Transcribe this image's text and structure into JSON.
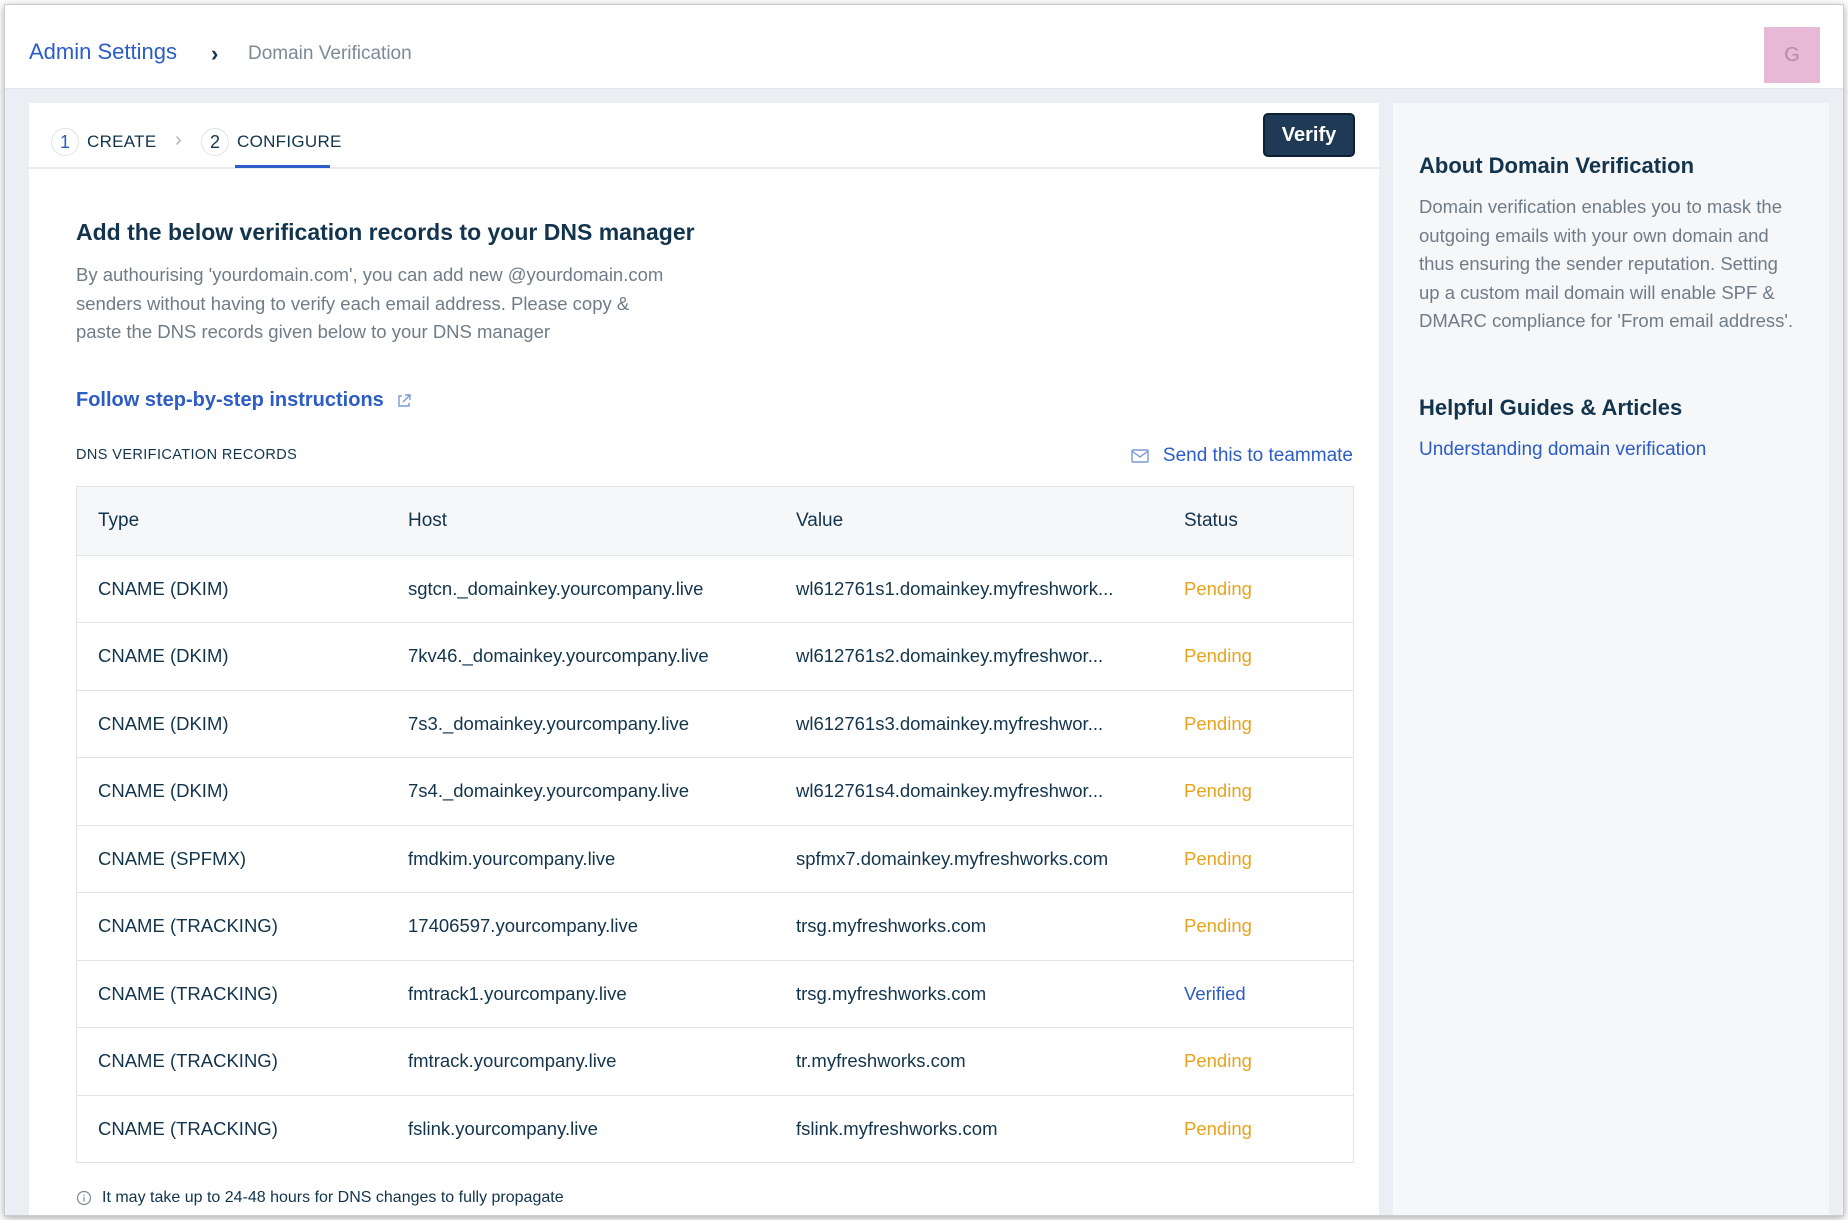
{
  "header": {
    "breadcrumb_root": "Admin Settings",
    "breadcrumb_separator": "›",
    "breadcrumb_current": "Domain Verification",
    "avatar_initial": "G"
  },
  "stepper": {
    "steps": [
      {
        "number": "1",
        "label": "CREATE"
      },
      {
        "number": "2",
        "label": "CONFIGURE"
      }
    ],
    "separator": "›",
    "active_step": 2,
    "verify_label": "Verify"
  },
  "content": {
    "title": "Add the below verification records to your DNS manager",
    "description": "By authourising 'yourdomain.com', you can add new @yourdomain.com senders without having to verify each email address. Please copy & paste the DNS records given below to your DNS manager",
    "follow_link": "Follow step-by-step instructions",
    "records_label": "DNS VERIFICATION RECORDS",
    "send_link": "Send this to teammate",
    "note": "It may take up to 24-48 hours for DNS changes to fully propagate"
  },
  "table": {
    "headers": {
      "type": "Type",
      "host": "Host",
      "value": "Value",
      "status": "Status"
    },
    "rows": [
      {
        "type": "CNAME (DKIM)",
        "host": "sgtcn._domainkey.yourcompany.live",
        "value": "wl612761s1.domainkey.myfreshwork...",
        "status": "Pending"
      },
      {
        "type": "CNAME (DKIM)",
        "host": "7kv46._domainkey.yourcompany.live",
        "value": "wl612761s2.domainkey.myfreshwor...",
        "status": "Pending"
      },
      {
        "type": "CNAME (DKIM)",
        "host": "7s3._domainkey.yourcompany.live",
        "value": "wl612761s3.domainkey.myfreshwor...",
        "status": "Pending"
      },
      {
        "type": "CNAME (DKIM)",
        "host": "7s4._domainkey.yourcompany.live",
        "value": "wl612761s4.domainkey.myfreshwor...",
        "status": "Pending"
      },
      {
        "type": "CNAME (SPFMX)",
        "host": "fmdkim.yourcompany.live",
        "value": "spfmx7.domainkey.myfreshworks.com",
        "status": "Pending"
      },
      {
        "type": "CNAME (TRACKING)",
        "host": "17406597.yourcompany.live",
        "value": "trsg.myfreshworks.com",
        "status": "Pending"
      },
      {
        "type": "CNAME (TRACKING)",
        "host": "fmtrack1.yourcompany.live",
        "value": "trsg.myfreshworks.com",
        "status": "Verified"
      },
      {
        "type": "CNAME (TRACKING)",
        "host": "fmtrack.yourcompany.live",
        "value": "tr.myfreshworks.com",
        "status": "Pending"
      },
      {
        "type": "CNAME (TRACKING)",
        "host": "fslink.yourcompany.live",
        "value": "fslink.myfreshworks.com",
        "status": "Pending"
      }
    ]
  },
  "side": {
    "about_title": "About Domain Verification",
    "about_text": "Domain verification enables you to mask the outgoing emails with your own domain and thus ensuring the sender reputation. Setting up a custom mail domain will enable SPF & DMARC compliance for 'From email address'.",
    "guides_title": "Helpful Guides & Articles",
    "guides_link": "Understanding domain verification"
  },
  "colors": {
    "accent": "#2c5cc5",
    "pending": "#e8a31c",
    "verified": "#2c5cc5",
    "button": "#1f3a56",
    "avatar_bg": "#e7b9d6"
  },
  "icons": [
    "external-link-icon",
    "mail-icon",
    "info-icon"
  ]
}
